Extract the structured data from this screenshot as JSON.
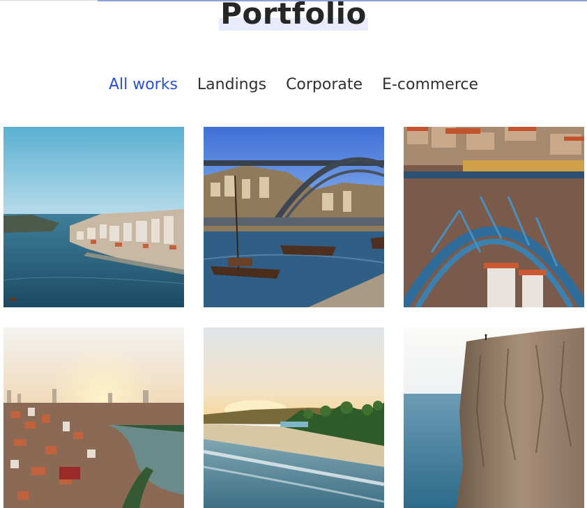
{
  "page": {
    "title": "Portfolio"
  },
  "filters": {
    "items": [
      {
        "label": "All works",
        "active": true
      },
      {
        "label": "Landings",
        "active": false
      },
      {
        "label": "Corporate",
        "active": false
      },
      {
        "label": "E-commerce",
        "active": false
      }
    ]
  },
  "colors": {
    "accent": "#2a4fd2",
    "text": "#262626",
    "title_highlight": "#e8ebfb"
  },
  "gallery": {
    "tiles": [
      {
        "subject": "river city with waterfront buildings"
      },
      {
        "subject": "iron arch bridge with wooden boats"
      },
      {
        "subject": "blue steel bridge arches with tram"
      },
      {
        "subject": "aerial city at sunset with river"
      },
      {
        "subject": "beach at sunrise with palm trees"
      },
      {
        "subject": "sea cliff with lone person on top"
      }
    ]
  }
}
